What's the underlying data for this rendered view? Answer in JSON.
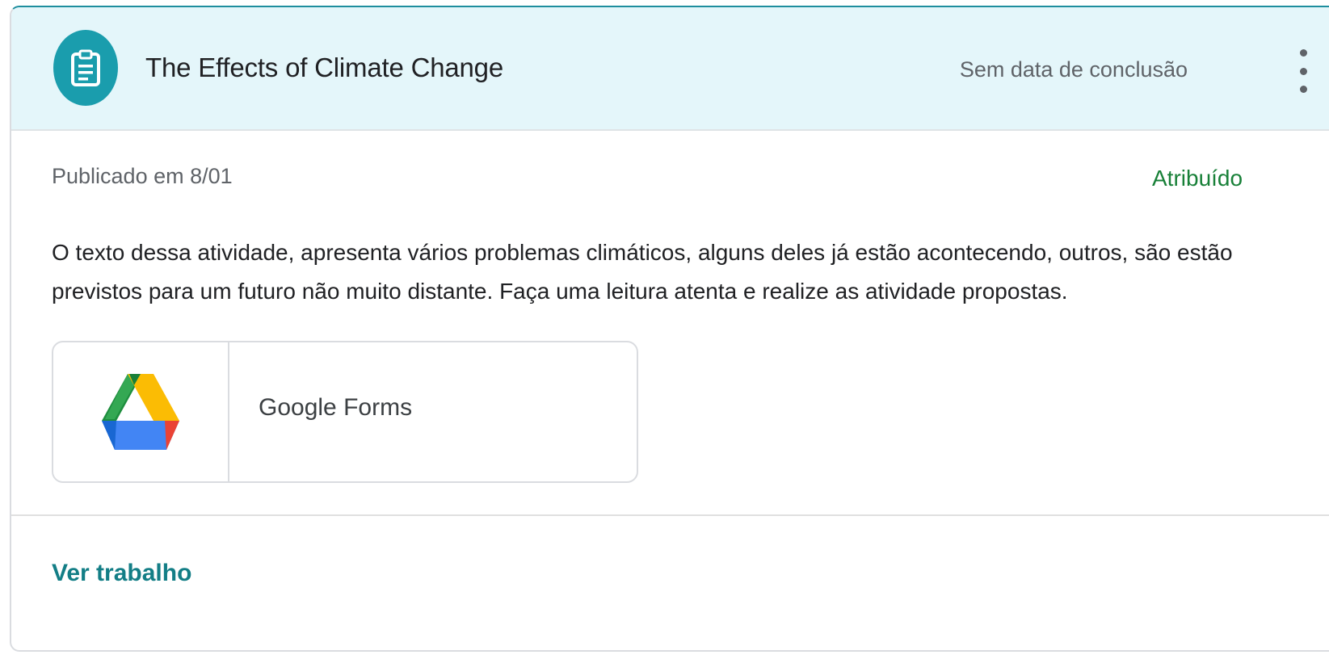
{
  "assignment": {
    "title": "The Effects of Climate Change",
    "due": "Sem data de conclusão",
    "icon": "assignment-icon",
    "more_icon": "more-vert-icon"
  },
  "details": {
    "published": "Publicado em 8/01",
    "status": "Atribuído",
    "status_color": "#188038",
    "description": "O texto dessa atividade, apresenta vários problemas climáticos, alguns deles já estão acontecendo, outros, são estão previstos para um futuro não muito distante. Faça uma leitura atenta e realize as atividade propostas."
  },
  "attachment": {
    "title": "Google Forms",
    "icon": "google-drive-icon"
  },
  "footer": {
    "view_work": "Ver trabalho"
  },
  "colors": {
    "header_bg": "#e4f6fa",
    "accent": "#1a9dad",
    "link": "#137e86"
  }
}
